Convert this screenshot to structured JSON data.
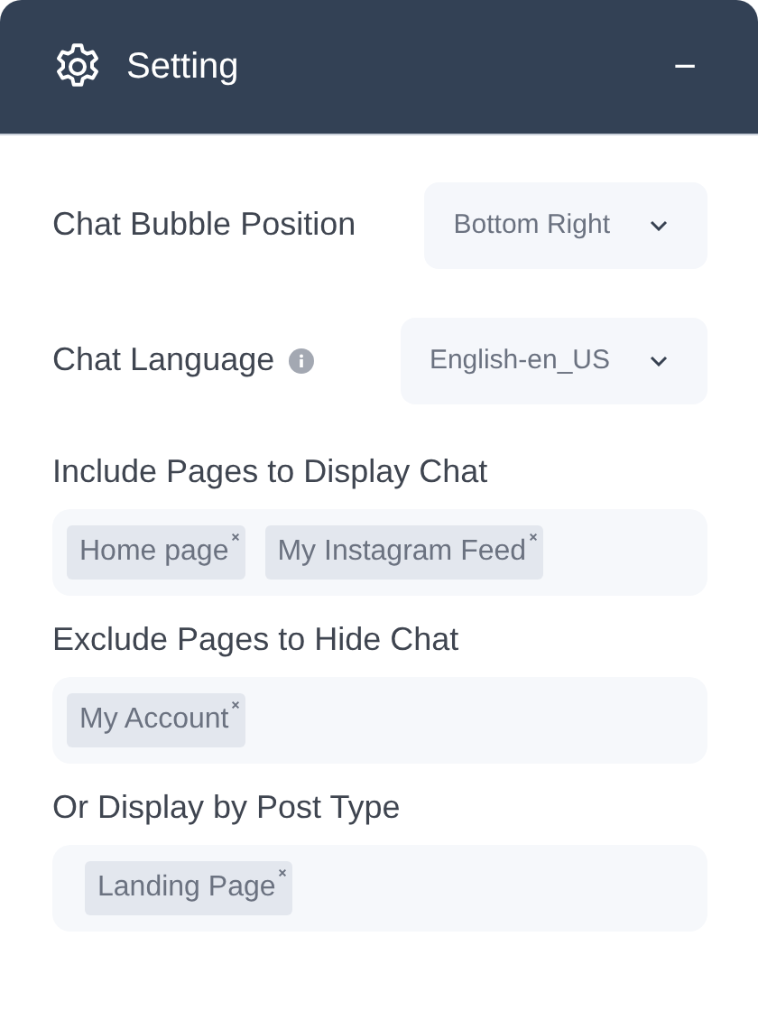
{
  "panel": {
    "title": "Setting",
    "collapse_symbol": "−"
  },
  "fields": [
    {
      "kind": "select",
      "label": "Chat Bubble Position",
      "info": false,
      "value": "Bottom Right"
    },
    {
      "kind": "select",
      "label": "Chat Language",
      "info": true,
      "value": "English-en_US"
    },
    {
      "kind": "tags",
      "label": "Include Pages to Display Chat",
      "tags": [
        "Home page",
        "My Instagram Feed"
      ]
    },
    {
      "kind": "tags",
      "label": "Exclude Pages to Hide Chat",
      "tags": [
        "My Account"
      ]
    },
    {
      "kind": "tags",
      "label": "Or Display by Post Type",
      "tags": [
        "Landing Page"
      ]
    }
  ]
}
